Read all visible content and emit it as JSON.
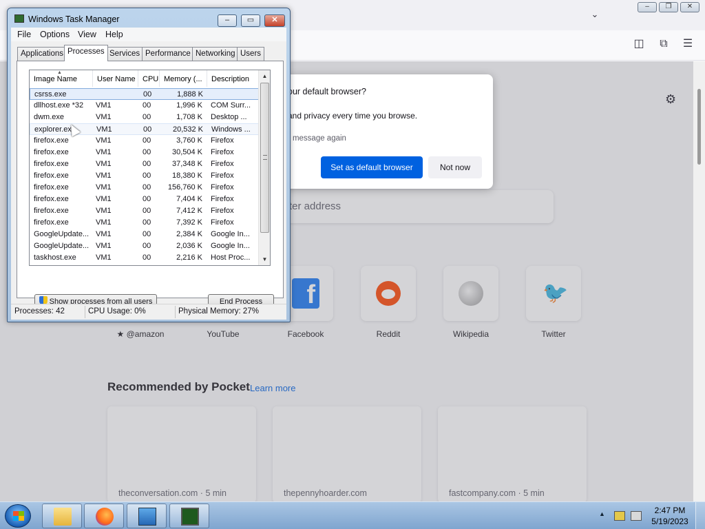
{
  "firefox": {
    "url_text": "ess",
    "dialog": {
      "question": "our default browser?",
      "description": "and privacy every time you browse.",
      "checkbox_label": "s message again",
      "primary_button": "Set as default browser",
      "secondary_button": "Not now"
    },
    "search_placeholder": "ter address",
    "shortcuts": [
      {
        "label": "@amazon",
        "icon": "amazon-icon"
      },
      {
        "label": "YouTube",
        "icon": "youtube-icon"
      },
      {
        "label": "Facebook",
        "icon": "facebook-icon"
      },
      {
        "label": "Reddit",
        "icon": "reddit-icon"
      },
      {
        "label": "Wikipedia",
        "icon": "wikipedia-icon"
      },
      {
        "label": "Twitter",
        "icon": "twitter-icon"
      }
    ],
    "pocket": {
      "title": "Recommended by Pocket",
      "learn_more": "Learn more",
      "cards": [
        {
          "source": "theconversation.com · 5 min"
        },
        {
          "source": "thepennyhoarder.com"
        },
        {
          "source": "fastcompany.com · 5 min"
        }
      ]
    }
  },
  "taskmgr": {
    "title": "Windows Task Manager",
    "menu": [
      "File",
      "Options",
      "View",
      "Help"
    ],
    "tabs": [
      "Applications",
      "Processes",
      "Services",
      "Performance",
      "Networking",
      "Users"
    ],
    "active_tab": "Processes",
    "columns": [
      "Image Name",
      "User Name",
      "CPU",
      "Memory (...",
      "Description"
    ],
    "rows": [
      {
        "image": "csrss.exe",
        "user": "",
        "cpu": "00",
        "mem": "1,888 K",
        "desc": ""
      },
      {
        "image": "dllhost.exe *32",
        "user": "VM1",
        "cpu": "00",
        "mem": "1,996 K",
        "desc": "COM Surr..."
      },
      {
        "image": "dwm.exe",
        "user": "VM1",
        "cpu": "00",
        "mem": "1,708 K",
        "desc": "Desktop ..."
      },
      {
        "image": "explorer.ex",
        "user": "VM1",
        "cpu": "00",
        "mem": "20,532 K",
        "desc": "Windows ..."
      },
      {
        "image": "firefox.exe",
        "user": "VM1",
        "cpu": "00",
        "mem": "3,760 K",
        "desc": "Firefox"
      },
      {
        "image": "firefox.exe",
        "user": "VM1",
        "cpu": "00",
        "mem": "30,504 K",
        "desc": "Firefox"
      },
      {
        "image": "firefox.exe",
        "user": "VM1",
        "cpu": "00",
        "mem": "37,348 K",
        "desc": "Firefox"
      },
      {
        "image": "firefox.exe",
        "user": "VM1",
        "cpu": "00",
        "mem": "18,380 K",
        "desc": "Firefox"
      },
      {
        "image": "firefox.exe",
        "user": "VM1",
        "cpu": "00",
        "mem": "156,760 K",
        "desc": "Firefox"
      },
      {
        "image": "firefox.exe",
        "user": "VM1",
        "cpu": "00",
        "mem": "7,404 K",
        "desc": "Firefox"
      },
      {
        "image": "firefox.exe",
        "user": "VM1",
        "cpu": "00",
        "mem": "7,412 K",
        "desc": "Firefox"
      },
      {
        "image": "firefox.exe",
        "user": "VM1",
        "cpu": "00",
        "mem": "7,392 K",
        "desc": "Firefox"
      },
      {
        "image": "GoogleUpdate...",
        "user": "VM1",
        "cpu": "00",
        "mem": "2,384 K",
        "desc": "Google In..."
      },
      {
        "image": "GoogleUpdate...",
        "user": "VM1",
        "cpu": "00",
        "mem": "2,036 K",
        "desc": "Google In..."
      },
      {
        "image": "taskhost.exe",
        "user": "VM1",
        "cpu": "00",
        "mem": "2,216 K",
        "desc": "Host Proc..."
      }
    ],
    "show_all_button": "Show processes from all users",
    "end_process_button": "End Process",
    "status": {
      "processes": "Processes: 42",
      "cpu": "CPU Usage: 0%",
      "memory": "Physical Memory: 27%"
    }
  },
  "taskbar": {
    "time": "2:47 PM",
    "date": "5/19/2023",
    "buttons": [
      "folder-icon",
      "firefox-icon",
      "control-panel-icon",
      "task-manager-icon"
    ]
  }
}
